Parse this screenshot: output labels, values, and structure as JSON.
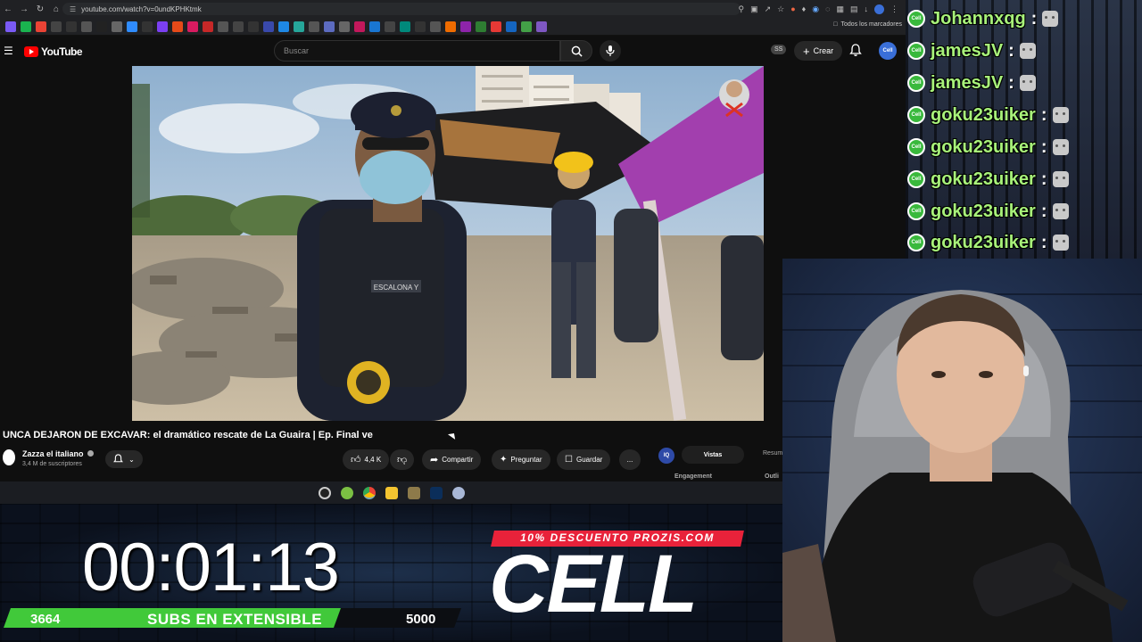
{
  "browser": {
    "url": "youtube.com/watch?v=0undKPHKtmk",
    "bookmarks_all_label": "Todos los marcadores"
  },
  "youtube": {
    "logo_text": "YouTube",
    "search_placeholder": "Buscar",
    "ss_badge": "SS",
    "create_label": "Crear",
    "avatar_text": "Cell",
    "video_title": "UNCA DEJARON DE EXCAVAR: el dramático rescate de La Guaira | Ep. Final ve",
    "channel": {
      "name": "Zazza el italiano",
      "subscribers": "3,4 M de suscriptores"
    },
    "actions": {
      "likes": "4,4 K",
      "share": "Compartir",
      "ask": "Preguntar",
      "save": "Guardar",
      "more": "..."
    },
    "side_panel": {
      "iq": "IQ",
      "tab_active": "Vistas",
      "tab_other": "Resum",
      "engagement": "Engagement",
      "outline": "Outli"
    },
    "video_overlay": {
      "vest_label": "ESCALONA Y"
    }
  },
  "stream_overlay": {
    "timer": "00:01:13",
    "subs_current": "3664",
    "subs_label": "SUBS EN EXTENSIBLE",
    "subs_goal": "5000",
    "subs_progress": 0.7328,
    "promo_text": "10% DESCUENTO PROZIS.COM",
    "brand": "CELL",
    "accent_green": "#41c93a",
    "accent_red": "#e8223a"
  },
  "chat": {
    "badge_text": "Cell",
    "separator": ":",
    "messages": [
      {
        "user": "Johannxqg"
      },
      {
        "user": "jamesJV"
      },
      {
        "user": "jamesJV"
      },
      {
        "user": "goku23uiker"
      },
      {
        "user": "goku23uiker"
      },
      {
        "user": "goku23uiker"
      },
      {
        "user": "goku23uiker"
      },
      {
        "user": "goku23uiker"
      }
    ]
  }
}
